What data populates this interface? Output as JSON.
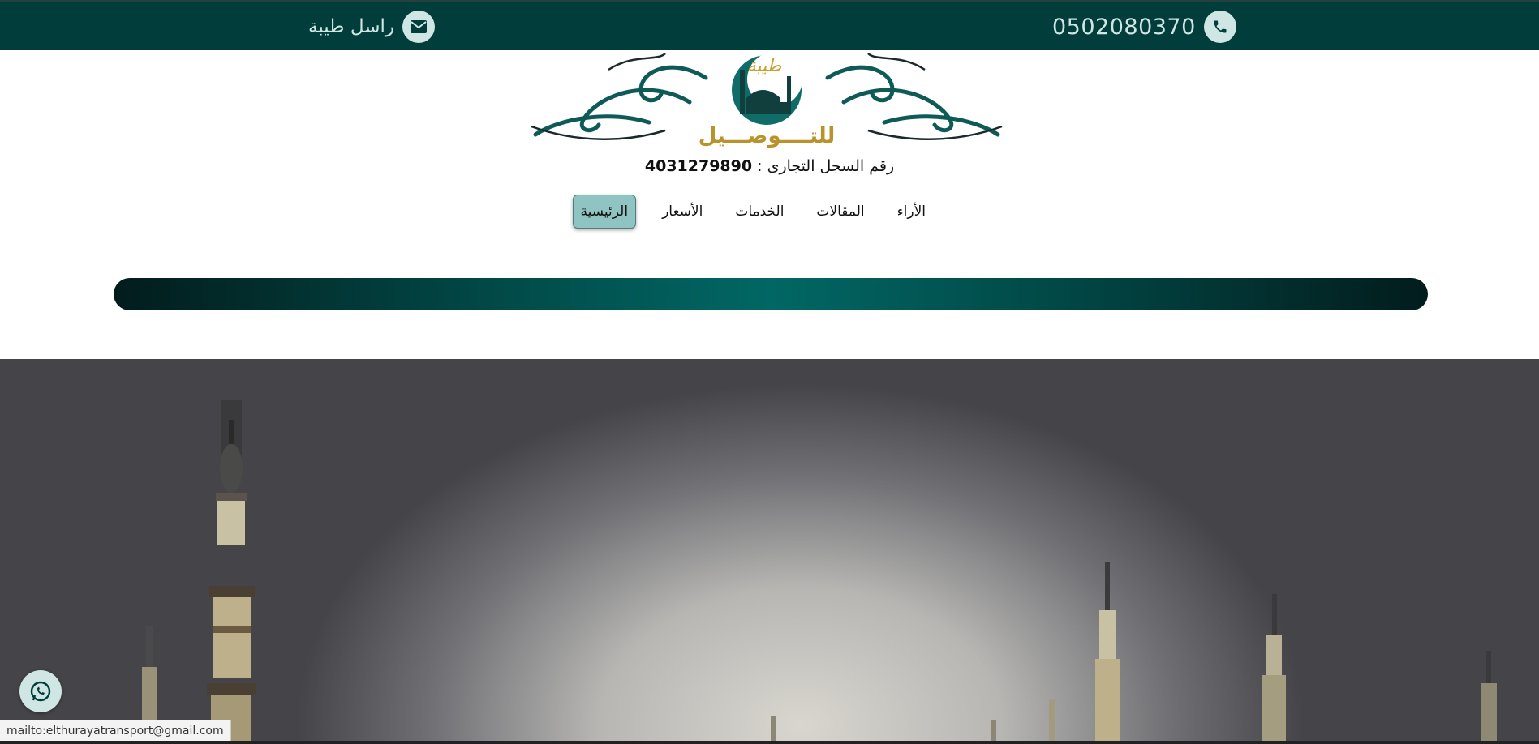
{
  "topbar": {
    "phone": "0502080370",
    "contact_label": "راسل طيبة",
    "phone_icon": "phone-icon",
    "mail_icon": "envelope-icon",
    "colors": {
      "bar": "#003d3b",
      "icon_bg": "#cfe6e4"
    }
  },
  "logo": {
    "brand_top": "طيبة",
    "brand_bottom": "للتــــوصـــيل"
  },
  "registration": {
    "label": "رقم السجل التجارى :",
    "number": "4031279890"
  },
  "nav": {
    "items": [
      {
        "label": "الرئيسية",
        "active": true
      },
      {
        "label": "الأسعار",
        "active": false
      },
      {
        "label": "الخدمات",
        "active": false
      },
      {
        "label": "المقالات",
        "active": false
      },
      {
        "label": "الأراء",
        "active": false
      }
    ]
  },
  "hero": {
    "image_description_icon": "mosque-minarets-image"
  },
  "floating": {
    "whatsapp_icon": "whatsapp-icon"
  },
  "status_bar": {
    "url": "mailto:elthurayatransport@gmail.com"
  }
}
